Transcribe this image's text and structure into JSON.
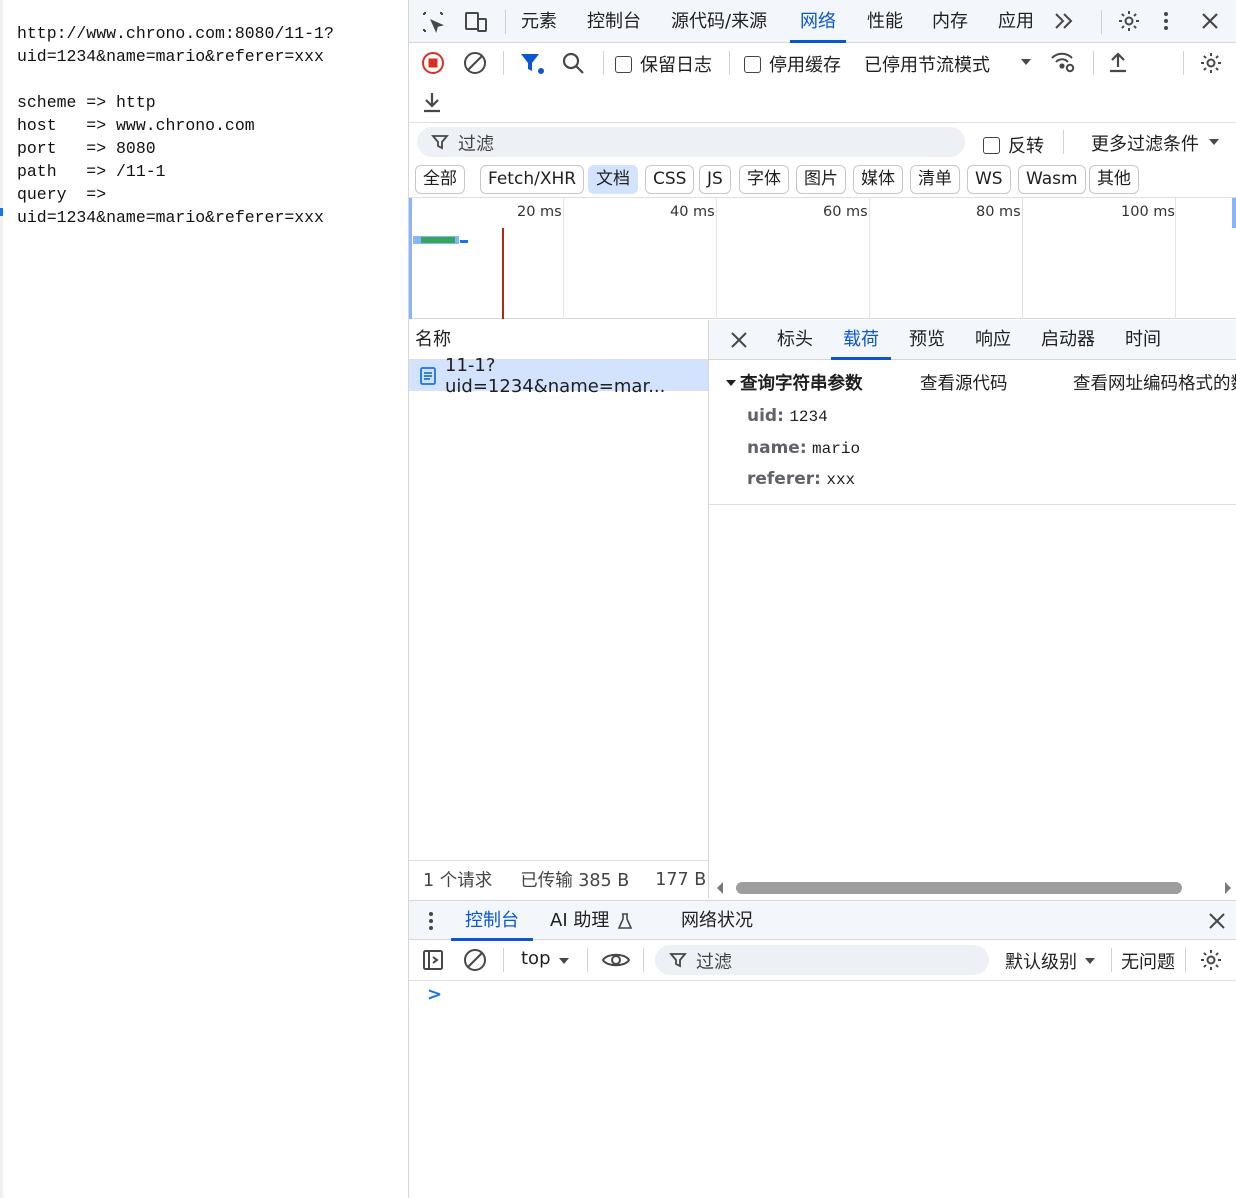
{
  "page": {
    "lines": [
      "http://www.chrono.com:8080/11-1?",
      "uid=1234&name=mario&referer=xxx",
      "",
      "scheme => http",
      "host   => www.chrono.com",
      "port   => 8080",
      "path   => /11-1",
      "query  =>",
      "uid=1234&name=mario&referer=xxx"
    ]
  },
  "devtools": {
    "main_tabs": [
      "元素",
      "控制台",
      "源代码/来源",
      "网络",
      "性能",
      "内存",
      "应用"
    ],
    "active_main_tab": "网络",
    "toolbar": {
      "preserve_log": "保留日志",
      "disable_cache": "停用缓存",
      "throttling": "已停用节流模式"
    },
    "filter": {
      "placeholder": "过滤",
      "invert": "反转",
      "more_filters": "更多过滤条件"
    },
    "type_chips": [
      "全部",
      "Fetch/XHR",
      "文档",
      "CSS",
      "JS",
      "字体",
      "图片",
      "媒体",
      "清单",
      "WS",
      "Wasm",
      "其他"
    ],
    "active_chip": "文档",
    "timeline": {
      "ticks": [
        "20 ms",
        "40 ms",
        "60 ms",
        "80 ms",
        "100 ms"
      ]
    },
    "requests": {
      "header": "名称",
      "items": [
        "11-1?uid=1234&name=mar..."
      ],
      "status": {
        "count": "1 个请求",
        "transferred": "已传输 385 B",
        "resources": "177 B"
      }
    },
    "detail_tabs": [
      "标头",
      "载荷",
      "预览",
      "响应",
      "启动器",
      "时间"
    ],
    "active_detail_tab": "载荷",
    "payload": {
      "section_title": "查询字符串参数",
      "view_source": "查看源代码",
      "view_encoded": "查看网址编码格式的数据",
      "params": [
        {
          "key": "uid:",
          "value": "1234"
        },
        {
          "key": "name:",
          "value": "mario"
        },
        {
          "key": "referer:",
          "value": "xxx"
        }
      ]
    },
    "drawer": {
      "tabs": [
        "控制台",
        "AI 助理",
        "网络状况"
      ],
      "active_tab": "控制台",
      "context": "top",
      "filter_placeholder": "过滤",
      "level": "默认级别",
      "issues": "无问题",
      "prompt": ">"
    },
    "colors": {
      "accent": "#0b57d0",
      "record_red": "#d93025",
      "selected_bg": "#d3e3fd"
    }
  }
}
